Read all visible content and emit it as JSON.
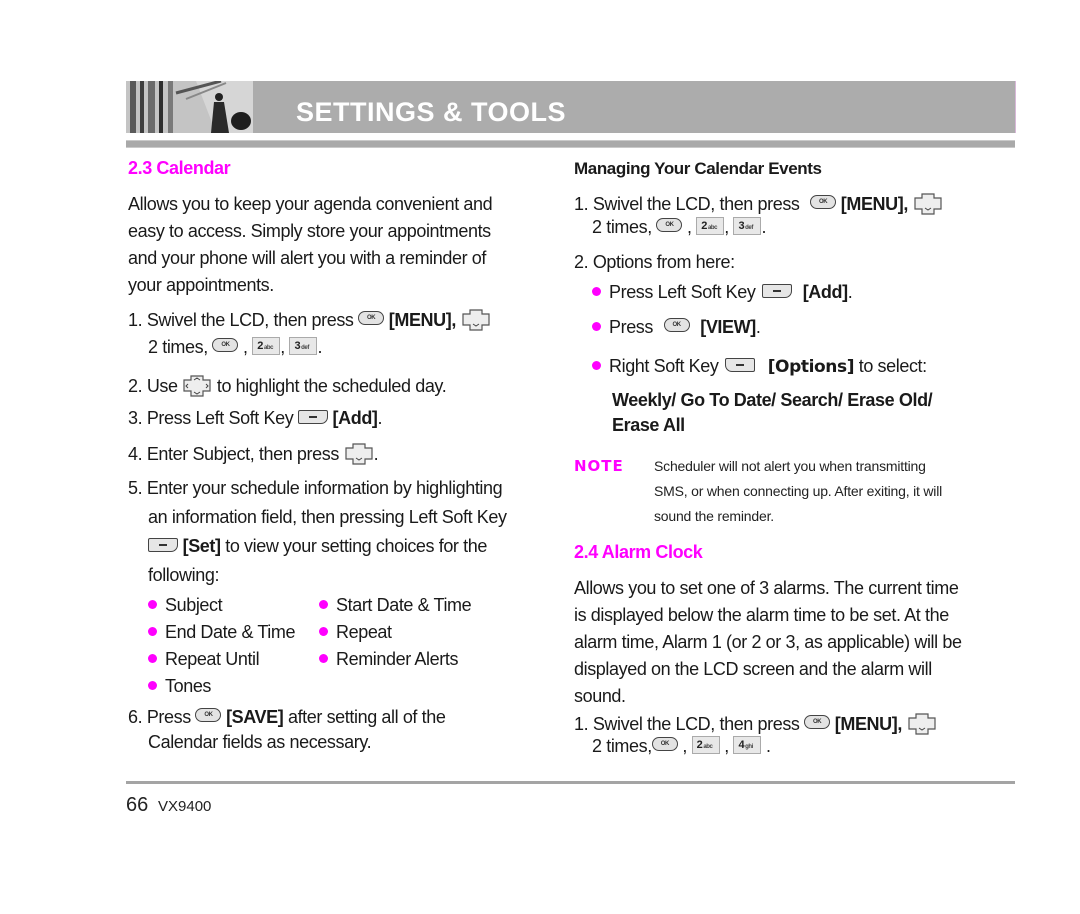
{
  "header": {
    "title": "SETTINGS & TOOLS",
    "photo": "banner-photo-person-escalator"
  },
  "left": {
    "heading": "2.3 Calendar",
    "intro": [
      "Allows you to keep your agenda convenient and",
      "easy to access. Simply store your appointments",
      "and your phone will alert you with a reminder of",
      "your appointments."
    ],
    "step1": {
      "num": "1.",
      "text": "Swivel the LCD, then press",
      "key_label": "[MENU],",
      "line2_prefix": "2 times,",
      "keys": [
        "OK",
        "2abc",
        "3def"
      ]
    },
    "step2": {
      "num": "2.",
      "pre": "Use",
      "post": "to highlight the scheduled day."
    },
    "step3": {
      "num": "3.",
      "pre": "Press Left Soft Key",
      "label": "[Add]",
      "end": "."
    },
    "step4": {
      "num": "4.",
      "pre": "Enter Subject, then press",
      "end": "."
    },
    "step5": {
      "num": "5.",
      "line1": "Enter your schedule information by highlighting",
      "line2": "an information field, then pressing Left Soft Key",
      "label": "[Set]",
      "line3_post": "to view your setting choices for the",
      "line4": "following:"
    },
    "fields": [
      "Subject",
      "Start Date & Time",
      "End Date & Time",
      "Repeat",
      "Repeat Until",
      "Reminder Alerts",
      "Tones"
    ],
    "step6": {
      "num": "6.",
      "pre": "Press",
      "label": "[SAVE]",
      "post": "after setting all of the",
      "line2": "Calendar fields as necessary."
    }
  },
  "right": {
    "subheading": "Managing Your Calendar Events",
    "step1": {
      "num": "1.",
      "text": "Swivel the LCD, then press",
      "key_label": "[MENU],",
      "line2_prefix": "2 times,",
      "keys": [
        "OK",
        "2abc",
        "3def"
      ]
    },
    "step2": {
      "num": "2.",
      "text": "Options from here:"
    },
    "options": [
      {
        "pre": "Press Left Soft Key",
        "label": "[Add]",
        "end": "."
      },
      {
        "pre": "Press",
        "label": "[VIEW]",
        "end": "."
      },
      {
        "pre": "Right Soft Key",
        "label": "[Options]",
        "end": "to select:"
      }
    ],
    "options_list": [
      "Weekly/ Go To Date/ Search/ Erase Old/",
      "Erase All"
    ],
    "note": {
      "label": "NOTE",
      "lines": [
        "Scheduler will not alert you when transmitting",
        "SMS, or when connecting up. After exiting, it will",
        "sound the reminder."
      ]
    },
    "alarm": {
      "heading": "2.4 Alarm Clock",
      "intro": [
        "Allows you to set one of 3 alarms. The current time",
        "is displayed below the alarm time to be set. At the",
        "alarm time, Alarm 1 (or 2 or 3, as applicable) will be",
        "displayed on the LCD screen and the alarm will",
        "sound."
      ],
      "step1": {
        "num": "1.",
        "text": "Swivel the LCD, then press",
        "key_label": "[MENU],",
        "line2_prefix": "2 times,",
        "keys": [
          "OK",
          "2abc",
          "4ghi"
        ]
      }
    }
  },
  "keys": {
    "ok": "OK",
    "num2": "2",
    "num2_sub": "abc",
    "num3": "3",
    "num3_sub": "def",
    "num4": "4",
    "num4_sub": "ghi"
  },
  "footer": {
    "page": "66",
    "model": "VX9400"
  },
  "colors": {
    "accent": "#ff00ff",
    "banner": "#acacac",
    "rule": "#a4a4a4"
  }
}
